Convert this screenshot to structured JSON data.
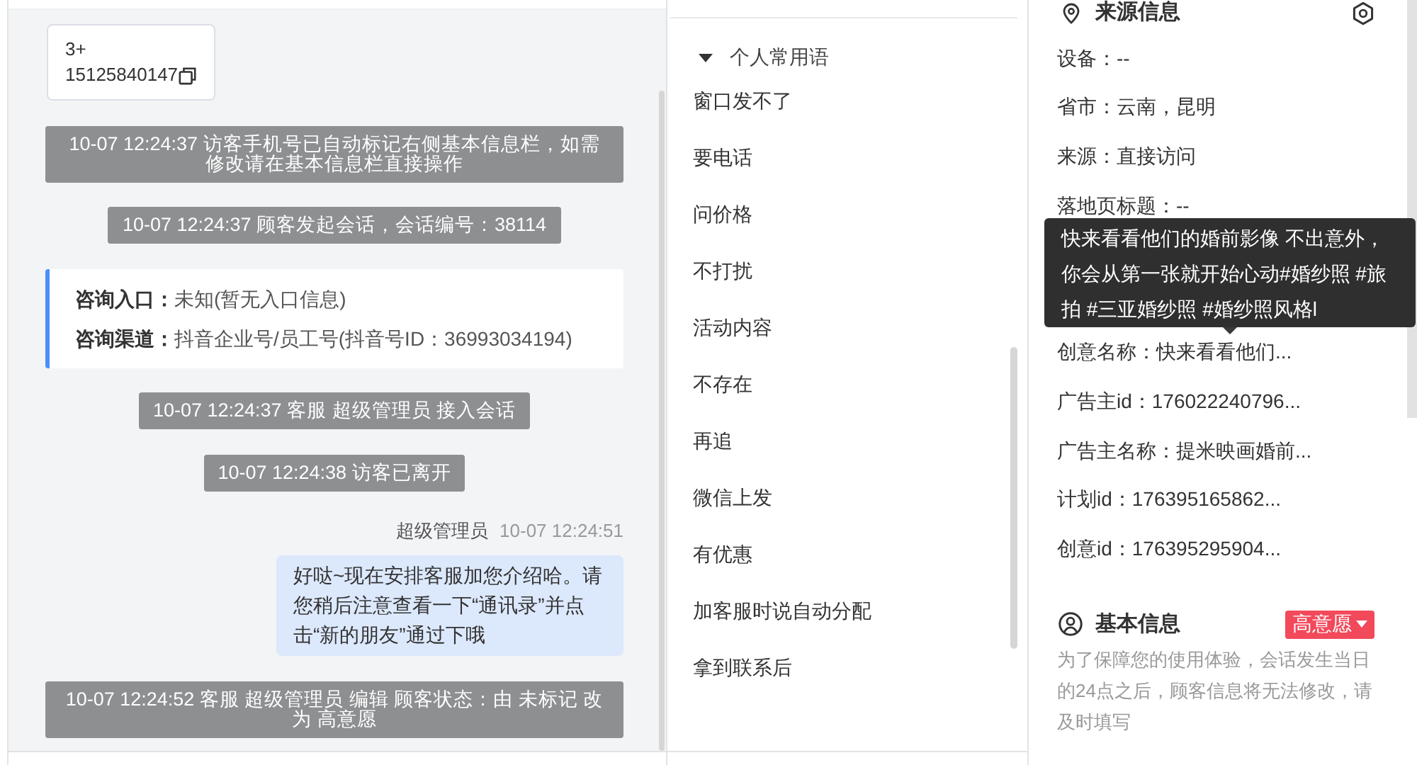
{
  "chat": {
    "contact_card": {
      "lines": [
        "3+",
        "15125840147"
      ]
    },
    "messages": [
      {
        "kind": "system",
        "text": "10-07 12:24:37 访客手机号已自动标记右侧基本信息栏，如需修改请在基本信息栏直接操作"
      },
      {
        "kind": "system",
        "text": "10-07 12:24:37 顾客发起会话，会话编号：38114"
      },
      {
        "kind": "entry_info",
        "lines": [
          "**咨询入口：**未知(暂无入口信息)",
          "**咨询渠道：**抖音企业号/员工号(抖音号ID：36993034194)"
        ]
      },
      {
        "kind": "system",
        "text": "10-07 12:24:37 客服 超级管理员 接入会话"
      },
      {
        "kind": "system",
        "text": "10-07 12:24:38 访客已离开"
      },
      {
        "kind": "agent",
        "sender": "超级管理员",
        "time": "10-07 12:24:51",
        "text": "好哒~现在安排客服加您介绍哈。请您稍后注意查看一下“通讯录”并点击“新的朋友”通过下哦"
      },
      {
        "kind": "system",
        "text": "10-07 12:24:52 客服 超级管理员 编辑 顾客状态：由 未标记 改为 高意愿"
      }
    ]
  },
  "phrases": {
    "group": {
      "label": "个人常用语",
      "expanded": true
    },
    "items": [
      "窗口发不了",
      "要电话",
      "问价格",
      "不打扰",
      "活动内容",
      "不存在",
      "再追",
      "微信上发",
      "有优惠",
      "加客服时说自动分配",
      "拿到联系后"
    ]
  },
  "source_info": {
    "title": "来源信息",
    "fields": [
      {
        "text": "设备：--"
      },
      {
        "text": "省市：云南，昆明"
      },
      {
        "text": "来源：直接访问"
      },
      {
        "text": "落地页标题：--"
      },
      {
        "text": "创意名称：快来看看他们...",
        "tooltip": "快来看看他们的婚前影像 不出意外，你会从第一张就开始心动#婚纱照 #旅拍 #三亚婚纱照 #婚纱照风格l"
      },
      {
        "text": "广告主id：176022240796..."
      },
      {
        "text": "广告主名称：提米映画婚前..."
      },
      {
        "text": "计划id：176395165862..."
      },
      {
        "text": "创意id：176395295904..."
      }
    ]
  },
  "basic_info": {
    "title": "基本信息",
    "status": "高意愿",
    "note": "为了保障您的使用体验，会话发生当日的24点之后，顾客信息将无法修改，请及时填写"
  }
}
